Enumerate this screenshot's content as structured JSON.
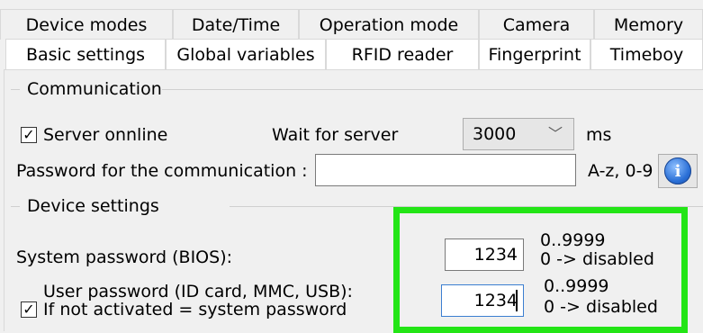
{
  "tabs_back": [
    "Device modes",
    "Date/Time",
    "Operation mode",
    "Camera",
    "Memory"
  ],
  "tabs_front": [
    "Basic settings",
    "Global variables",
    "RFID reader",
    "Fingerprint",
    "Timeboy"
  ],
  "communication": {
    "group_label": "Communication",
    "server_online_label": "Server onnline",
    "server_online_checked": true,
    "wait_label": "Wait for server",
    "wait_value": "3000",
    "wait_unit": "ms",
    "password_label": "Password for the communication :",
    "password_value": "",
    "password_hint": "A-z, 0-9"
  },
  "device_settings": {
    "group_label": "Device settings",
    "system_password_label": "System password (BIOS):",
    "system_password_value": "1234",
    "system_range": "0..9999",
    "system_note": "0 -> disabled",
    "user_password_label": "User password (ID card, MMC, USB):",
    "user_password_sublabel": "If not activated = system password",
    "user_password_checked": true,
    "user_password_value": "1234",
    "user_range": "0..9999",
    "user_note": "0 -> disabled"
  },
  "icons": {
    "info": "info-icon",
    "checkmark": "checkmark-icon",
    "dropdown": "chevron-down-icon"
  },
  "colors": {
    "highlight": "#23e516",
    "info_blue": "#2a6fd6"
  }
}
